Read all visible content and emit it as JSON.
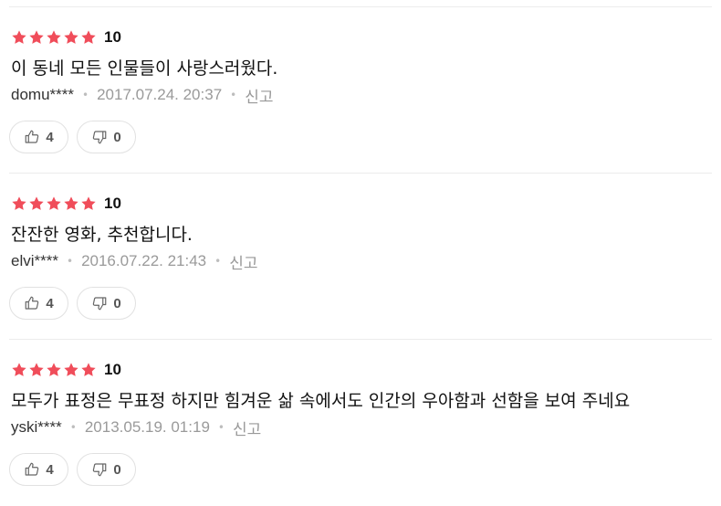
{
  "colors": {
    "star": "#f04d5a",
    "divider": "#ececec",
    "meta": "#999999"
  },
  "reviews": [
    {
      "score": "10",
      "stars": 5,
      "text": "이 동네 모든 인물들이 사랑스러웠다.",
      "user": "domu****",
      "date": "2017.07.24. 20:37",
      "report": "신고",
      "likes": "4",
      "dislikes": "0"
    },
    {
      "score": "10",
      "stars": 5,
      "text": "잔잔한 영화, 추천합니다.",
      "user": "elvi****",
      "date": "2016.07.22. 21:43",
      "report": "신고",
      "likes": "4",
      "dislikes": "0"
    },
    {
      "score": "10",
      "stars": 5,
      "text": "모두가 표정은 무표정 하지만 힘겨운 삶 속에서도 인간의 우아함과 선함을 보여 주네요",
      "user": "yski****",
      "date": "2013.05.19. 01:19",
      "report": "신고",
      "likes": "4",
      "dislikes": "0"
    }
  ]
}
